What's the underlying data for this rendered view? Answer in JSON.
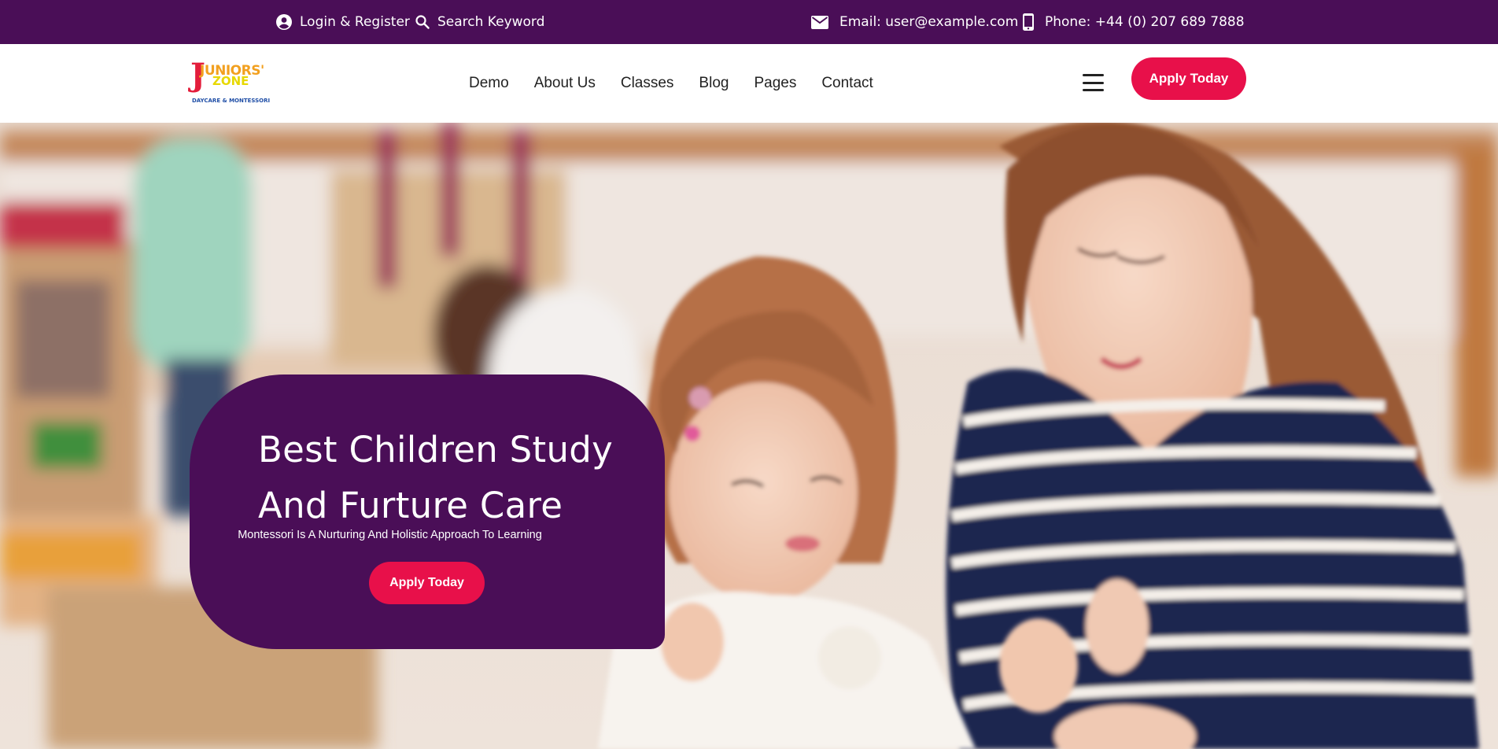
{
  "topbar": {
    "login_label": "Login & Register",
    "search_label": "Search Keyword",
    "email_label": "Email: user@example.com",
    "phone_label": "Phone: +44 (0) 207 689 7888",
    "icons": [
      "user-circle-icon",
      "search-icon",
      "mail-icon",
      "phone-icon"
    ]
  },
  "header": {
    "logo": {
      "line1": "JUNIORS'",
      "line2": "ZONE",
      "tagline": "DAYCARE & MONTESSORI"
    },
    "nav": [
      {
        "label": "Demo"
      },
      {
        "label": "About Us"
      },
      {
        "label": "Classes"
      },
      {
        "label": "Blog"
      },
      {
        "label": "Pages"
      },
      {
        "label": "Contact"
      }
    ],
    "cta_label": "Apply Today"
  },
  "hero": {
    "title": "Best Children Study And Furture Care",
    "subtitle": "Montessori Is A Nurturing And Holistic Approach To Learning",
    "cta_label": "Apply Today"
  },
  "colors": {
    "primary_purple": "#4a0e57",
    "accent_red": "#e8104a",
    "text_dark": "#222222",
    "white": "#ffffff"
  }
}
